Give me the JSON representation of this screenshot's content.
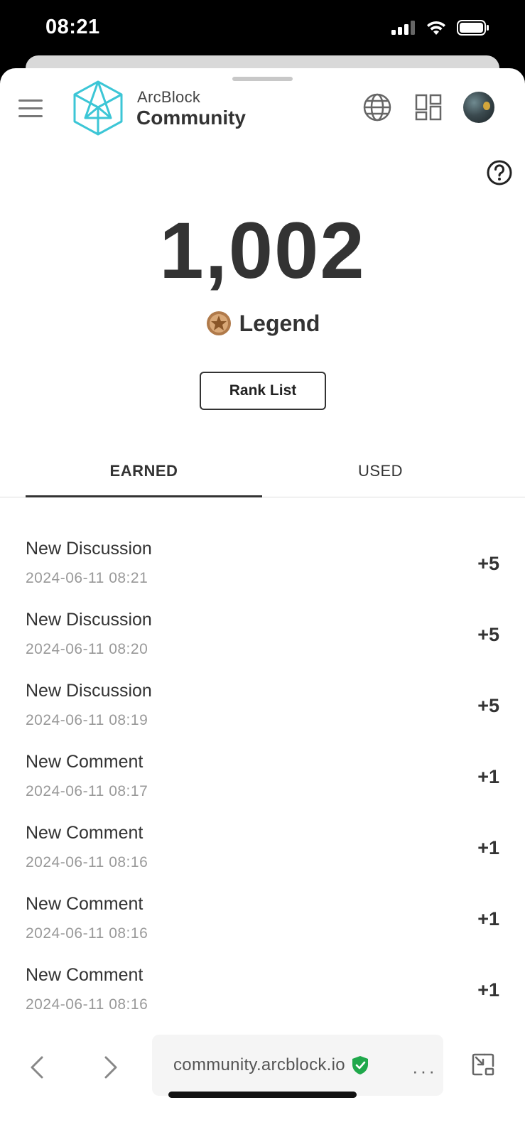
{
  "status_bar": {
    "time": "08:21"
  },
  "header": {
    "logo_top": "ArcBlock",
    "logo_bottom": "Community"
  },
  "points": {
    "value": "1,002",
    "level": "Legend"
  },
  "rank_button": "Rank List",
  "tabs": [
    {
      "label": "EARNED",
      "active": true
    },
    {
      "label": "USED",
      "active": false
    }
  ],
  "items": [
    {
      "title": "New Discussion",
      "date": "2024-06-11 08:21",
      "points": "+5"
    },
    {
      "title": "New Discussion",
      "date": "2024-06-11 08:20",
      "points": "+5"
    },
    {
      "title": "New Discussion",
      "date": "2024-06-11 08:19",
      "points": "+5"
    },
    {
      "title": "New Comment",
      "date": "2024-06-11 08:17",
      "points": "+1"
    },
    {
      "title": "New Comment",
      "date": "2024-06-11 08:16",
      "points": "+1"
    },
    {
      "title": "New Comment",
      "date": "2024-06-11 08:16",
      "points": "+1"
    },
    {
      "title": "New Comment",
      "date": "2024-06-11 08:16",
      "points": "+1"
    }
  ],
  "browser": {
    "url": "community.arcblock.io",
    "more": "···"
  },
  "colors": {
    "logo_accent": "#3cc6d6",
    "secure_shield": "#1fa84b",
    "text_primary": "#333333",
    "text_secondary": "#999999"
  }
}
